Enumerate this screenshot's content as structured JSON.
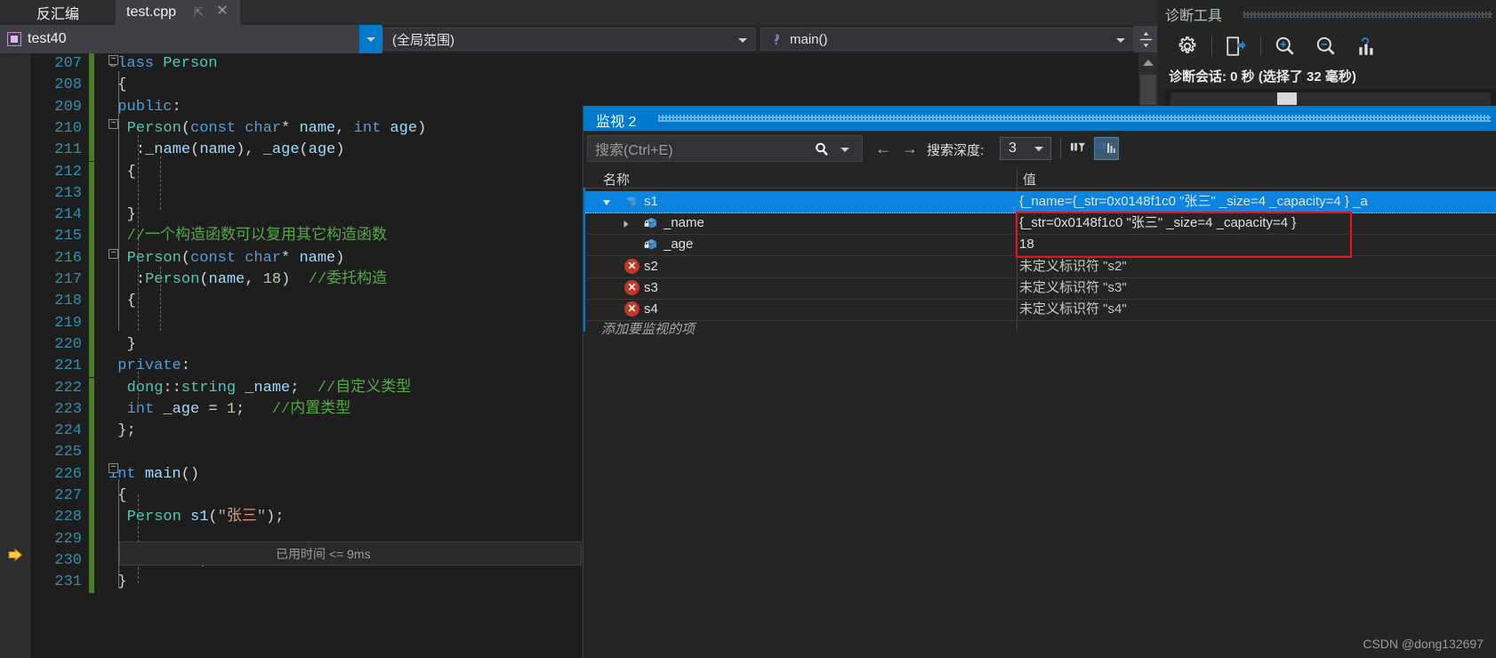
{
  "tabs": {
    "disassembly": "反汇编",
    "active_file": "test.cpp",
    "pin_icon": "pin-icon",
    "close_icon": "close-icon",
    "chevron_icon": "chevron-down-icon",
    "gear_icon": "gear-icon"
  },
  "navbar": {
    "project": "test40",
    "scope": "(全局范围)",
    "function": "main()",
    "split_icon": "split-window-icon"
  },
  "editor": {
    "lines": [
      {
        "num": "207",
        "text": "class Person"
      },
      {
        "num": "208",
        "text": "{"
      },
      {
        "num": "209",
        "text": "public:"
      },
      {
        "num": "210",
        "text": "Person(const char* name, int age)"
      },
      {
        "num": "211",
        "text": ":_name(name), _age(age)"
      },
      {
        "num": "212",
        "text": "{"
      },
      {
        "num": "213",
        "text": ""
      },
      {
        "num": "214",
        "text": "}"
      },
      {
        "num": "215",
        "text": "//一个构造函数可以复用其它构造函数"
      },
      {
        "num": "216",
        "text": "Person(const char* name)"
      },
      {
        "num": "217",
        "text": ":Person(name, 18)  //委托构造"
      },
      {
        "num": "218",
        "text": "{"
      },
      {
        "num": "219",
        "text": ""
      },
      {
        "num": "220",
        "text": "}"
      },
      {
        "num": "221",
        "text": "private:"
      },
      {
        "num": "222",
        "text": "dong::string _name;  //自定义类型"
      },
      {
        "num": "223",
        "text": "int _age = 1;   //内置类型"
      },
      {
        "num": "224",
        "text": "};"
      },
      {
        "num": "225",
        "text": ""
      },
      {
        "num": "226",
        "text": "int main()"
      },
      {
        "num": "227",
        "text": "{"
      },
      {
        "num": "228",
        "text": "Person s1(\"张三\");"
      },
      {
        "num": "229",
        "text": ""
      },
      {
        "num": "230",
        "text": "return 0;"
      },
      {
        "num": "231",
        "text": "}"
      }
    ],
    "elapsed_annotation": "已用时间 <= 9ms",
    "exec_arrow_icon": "execution-pointer-icon"
  },
  "diagnostics": {
    "title": "诊断工具",
    "session_text": "诊断会话: 0 秒 (选择了 32 毫秒)",
    "buttons": [
      {
        "icon": "gear-icon",
        "name": "settings-button"
      },
      {
        "icon": "export-icon",
        "name": "export-button"
      },
      {
        "icon": "zoom-in-icon",
        "name": "zoom-in-button"
      },
      {
        "icon": "zoom-out-icon",
        "name": "zoom-out-button"
      },
      {
        "icon": "chart-icon",
        "name": "select-chart-button"
      }
    ]
  },
  "watch": {
    "title": "监视 2",
    "search_placeholder": "搜索(Ctrl+E)",
    "search_icon": "search-icon",
    "nav_back_icon": "arrow-left-icon",
    "nav_forward_icon": "arrow-right-icon",
    "depth_label": "搜索深度:",
    "depth_value": "3",
    "filter_icon": "filter-icon",
    "hex_icon": "hexadecimal-display-icon",
    "columns": {
      "name": "名称",
      "value": "值"
    },
    "rows": [
      {
        "name": "s1",
        "value": "{_name={_str=0x0148f1c0 \"张三\" _size=4 _capacity=4 } _a",
        "icon": "object-icon",
        "expander": "expanded",
        "indent": 44,
        "selected": true,
        "error": false
      },
      {
        "name": "_name",
        "value": "{_str=0x0148f1c0 \"张三\" _size=4 _capacity=4 }",
        "icon": "private-field-icon",
        "expander": "collapsed",
        "indent": 66,
        "selected": false,
        "error": false
      },
      {
        "name": "_age",
        "value": "18",
        "icon": "private-field-icon",
        "expander": "none",
        "indent": 66,
        "selected": false,
        "error": false
      },
      {
        "name": "s2",
        "value": "未定义标识符 \"s2\"",
        "icon": "error-icon",
        "expander": "none",
        "indent": 44,
        "selected": false,
        "error": true
      },
      {
        "name": "s3",
        "value": "未定义标识符 \"s3\"",
        "icon": "error-icon",
        "expander": "none",
        "indent": 44,
        "selected": false,
        "error": true
      },
      {
        "name": "s4",
        "value": "未定义标识符 \"s4\"",
        "icon": "error-icon",
        "expander": "none",
        "indent": 44,
        "selected": false,
        "error": true
      }
    ],
    "add_item_placeholder": "添加要监视的项"
  },
  "watermark": "CSDN @dong132697",
  "colors": {
    "accent": "#007acc",
    "selection": "#0a84e0",
    "error": "#c0392b",
    "highlight_box": "#e81123"
  }
}
